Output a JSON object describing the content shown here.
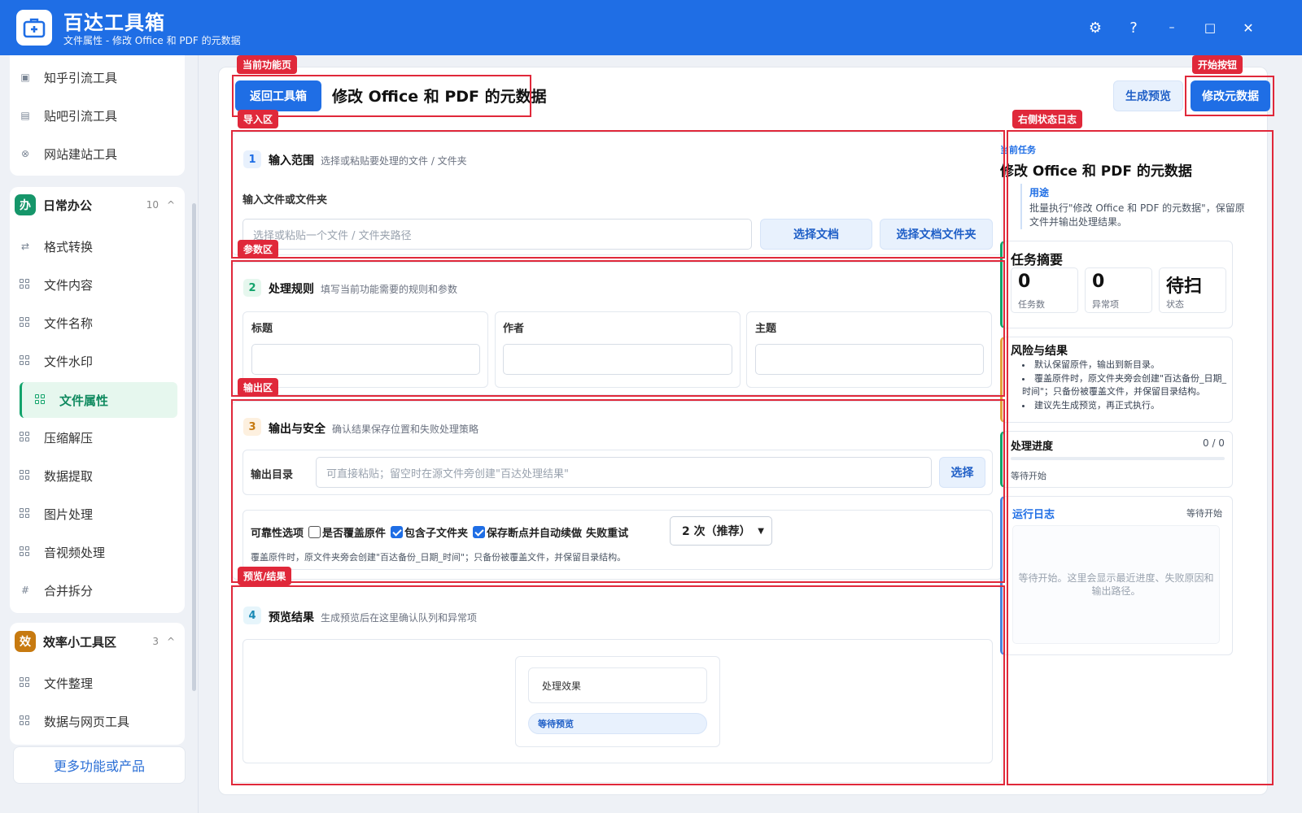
{
  "app": {
    "title": "百达工具箱",
    "subtitle": "文件属性 - 修改 Office 和 PDF 的元数据"
  },
  "window_controls": {
    "settings": "⚙",
    "help": "?",
    "minimize": "–",
    "maximize": "□",
    "close": "✕"
  },
  "sidebar": {
    "top_items": [
      {
        "label": "知乎引流工具"
      },
      {
        "label": "贴吧引流工具"
      },
      {
        "label": "网站建站工具"
      }
    ],
    "group_office": {
      "badge": "办",
      "title": "日常办公",
      "count": "10",
      "caret": "^",
      "items": [
        {
          "label": "格式转换"
        },
        {
          "label": "文件内容"
        },
        {
          "label": "文件名称"
        },
        {
          "label": "文件水印"
        },
        {
          "label": "文件属性"
        },
        {
          "label": "压缩解压"
        },
        {
          "label": "数据提取"
        },
        {
          "label": "图片处理"
        },
        {
          "label": "音视频处理"
        },
        {
          "label": "合并拆分"
        }
      ]
    },
    "group_efficiency": {
      "badge": "效",
      "title": "效率小工具区",
      "count": "3",
      "caret": "^",
      "items": [
        {
          "label": "文件整理"
        },
        {
          "label": "数据与网页工具"
        }
      ]
    },
    "more_button": "更多功能或产品"
  },
  "header": {
    "back_button": "返回工具箱",
    "page_title": "修改 Office 和 PDF 的元数据",
    "preview_button": "生成预览",
    "start_button": "修改元数据"
  },
  "annotations": {
    "current_page": "当前功能页",
    "start_button": "开始按钮",
    "import": "导入区",
    "right_log": "右侧状态日志",
    "params": "参数区",
    "output": "输出区",
    "preview": "预览/结果"
  },
  "section_input": {
    "num": "1",
    "title": "输入范围",
    "desc": "选择或粘贴要处理的文件 / 文件夹",
    "field_label": "输入文件或文件夹",
    "placeholder": "选择或粘贴一个文件 / 文件夹路径",
    "btn_doc": "选择文档",
    "btn_folder": "选择文档文件夹"
  },
  "section_rules": {
    "num": "2",
    "title": "处理规则",
    "desc": "填写当前功能需要的规则和参数",
    "fields": [
      {
        "label": "标题",
        "value": ""
      },
      {
        "label": "作者",
        "value": ""
      },
      {
        "label": "主题",
        "value": ""
      }
    ]
  },
  "section_output": {
    "num": "3",
    "title": "输出与安全",
    "desc": "确认结果保存位置和失败处理策略",
    "dir_label": "输出目录",
    "dir_placeholder": "可直接粘贴；留空时在源文件旁创建\"百达处理结果\"",
    "dir_button": "选择",
    "options_label": "可靠性选项",
    "opt_overwrite": "是否覆盖原件",
    "opt_overwrite_checked": false,
    "opt_subfolders": "包含子文件夹",
    "opt_subfolders_checked": true,
    "opt_resume": "保存断点并自动续做",
    "opt_resume_checked": true,
    "retry_label": "失败重试",
    "retry_value": "2 次（推荐）",
    "note": "覆盖原件时，原文件夹旁会创建\"百达备份_日期_时间\"；只备份被覆盖文件，并保留目录结构。"
  },
  "section_preview": {
    "num": "4",
    "title": "预览结果",
    "desc": "生成预览后在这里确认队列和异常项",
    "effect_label": "处理效果",
    "status_chip": "等待预览"
  },
  "right_panel": {
    "current_task_label": "当前任务",
    "task_title": "修改 Office 和 PDF 的元数据",
    "purpose_label": "用途",
    "purpose_text": "批量执行\"修改 Office 和 PDF 的元数据\"，保留原文件并输出处理结果。",
    "summary_title": "任务摘要",
    "kpis": [
      {
        "value": "0",
        "label": "任务数"
      },
      {
        "value": "0",
        "label": "异常项"
      },
      {
        "value": "待扫",
        "label": "状态"
      }
    ],
    "risk_title": "风险与结果",
    "risk_items": [
      "默认保留原件，输出到新目录。",
      "覆盖原件时，原文件夹旁会创建\"百达备份_日期_时间\"；只备份被覆盖文件，并保留目录结构。",
      "建议先生成预览，再正式执行。"
    ],
    "progress_title": "处理进度",
    "progress_count": "0 / 0",
    "progress_fraction": 0,
    "progress_status": "等待开始",
    "log_title": "运行日志",
    "log_status": "等待开始",
    "log_placeholder": "等待开始。这里会显示最近进度、失败原因和输出路径。"
  },
  "colors": {
    "primary": "#1f6ee5",
    "annotation": "#e0283a",
    "active_green": "#12a36b",
    "badge_office": "#16966a",
    "badge_efficiency": "#c77a10"
  }
}
